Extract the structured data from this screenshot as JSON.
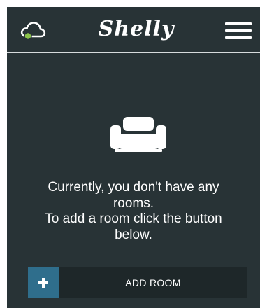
{
  "header": {
    "logo_text": "Shelly",
    "cloud_status_color": "#8bc34a"
  },
  "empty_state": {
    "icon": "sofa-icon",
    "message_lines": [
      "Currently, you don't have any",
      "rooms.",
      "To add a room click the button",
      "below."
    ]
  },
  "add_room": {
    "icon": "plus-icon",
    "label": "ADD ROOM"
  },
  "colors": {
    "background": "#283336",
    "header_divider": "#d7dcdd",
    "button_background": "#1e2729",
    "button_accent": "#2f6e8c"
  }
}
